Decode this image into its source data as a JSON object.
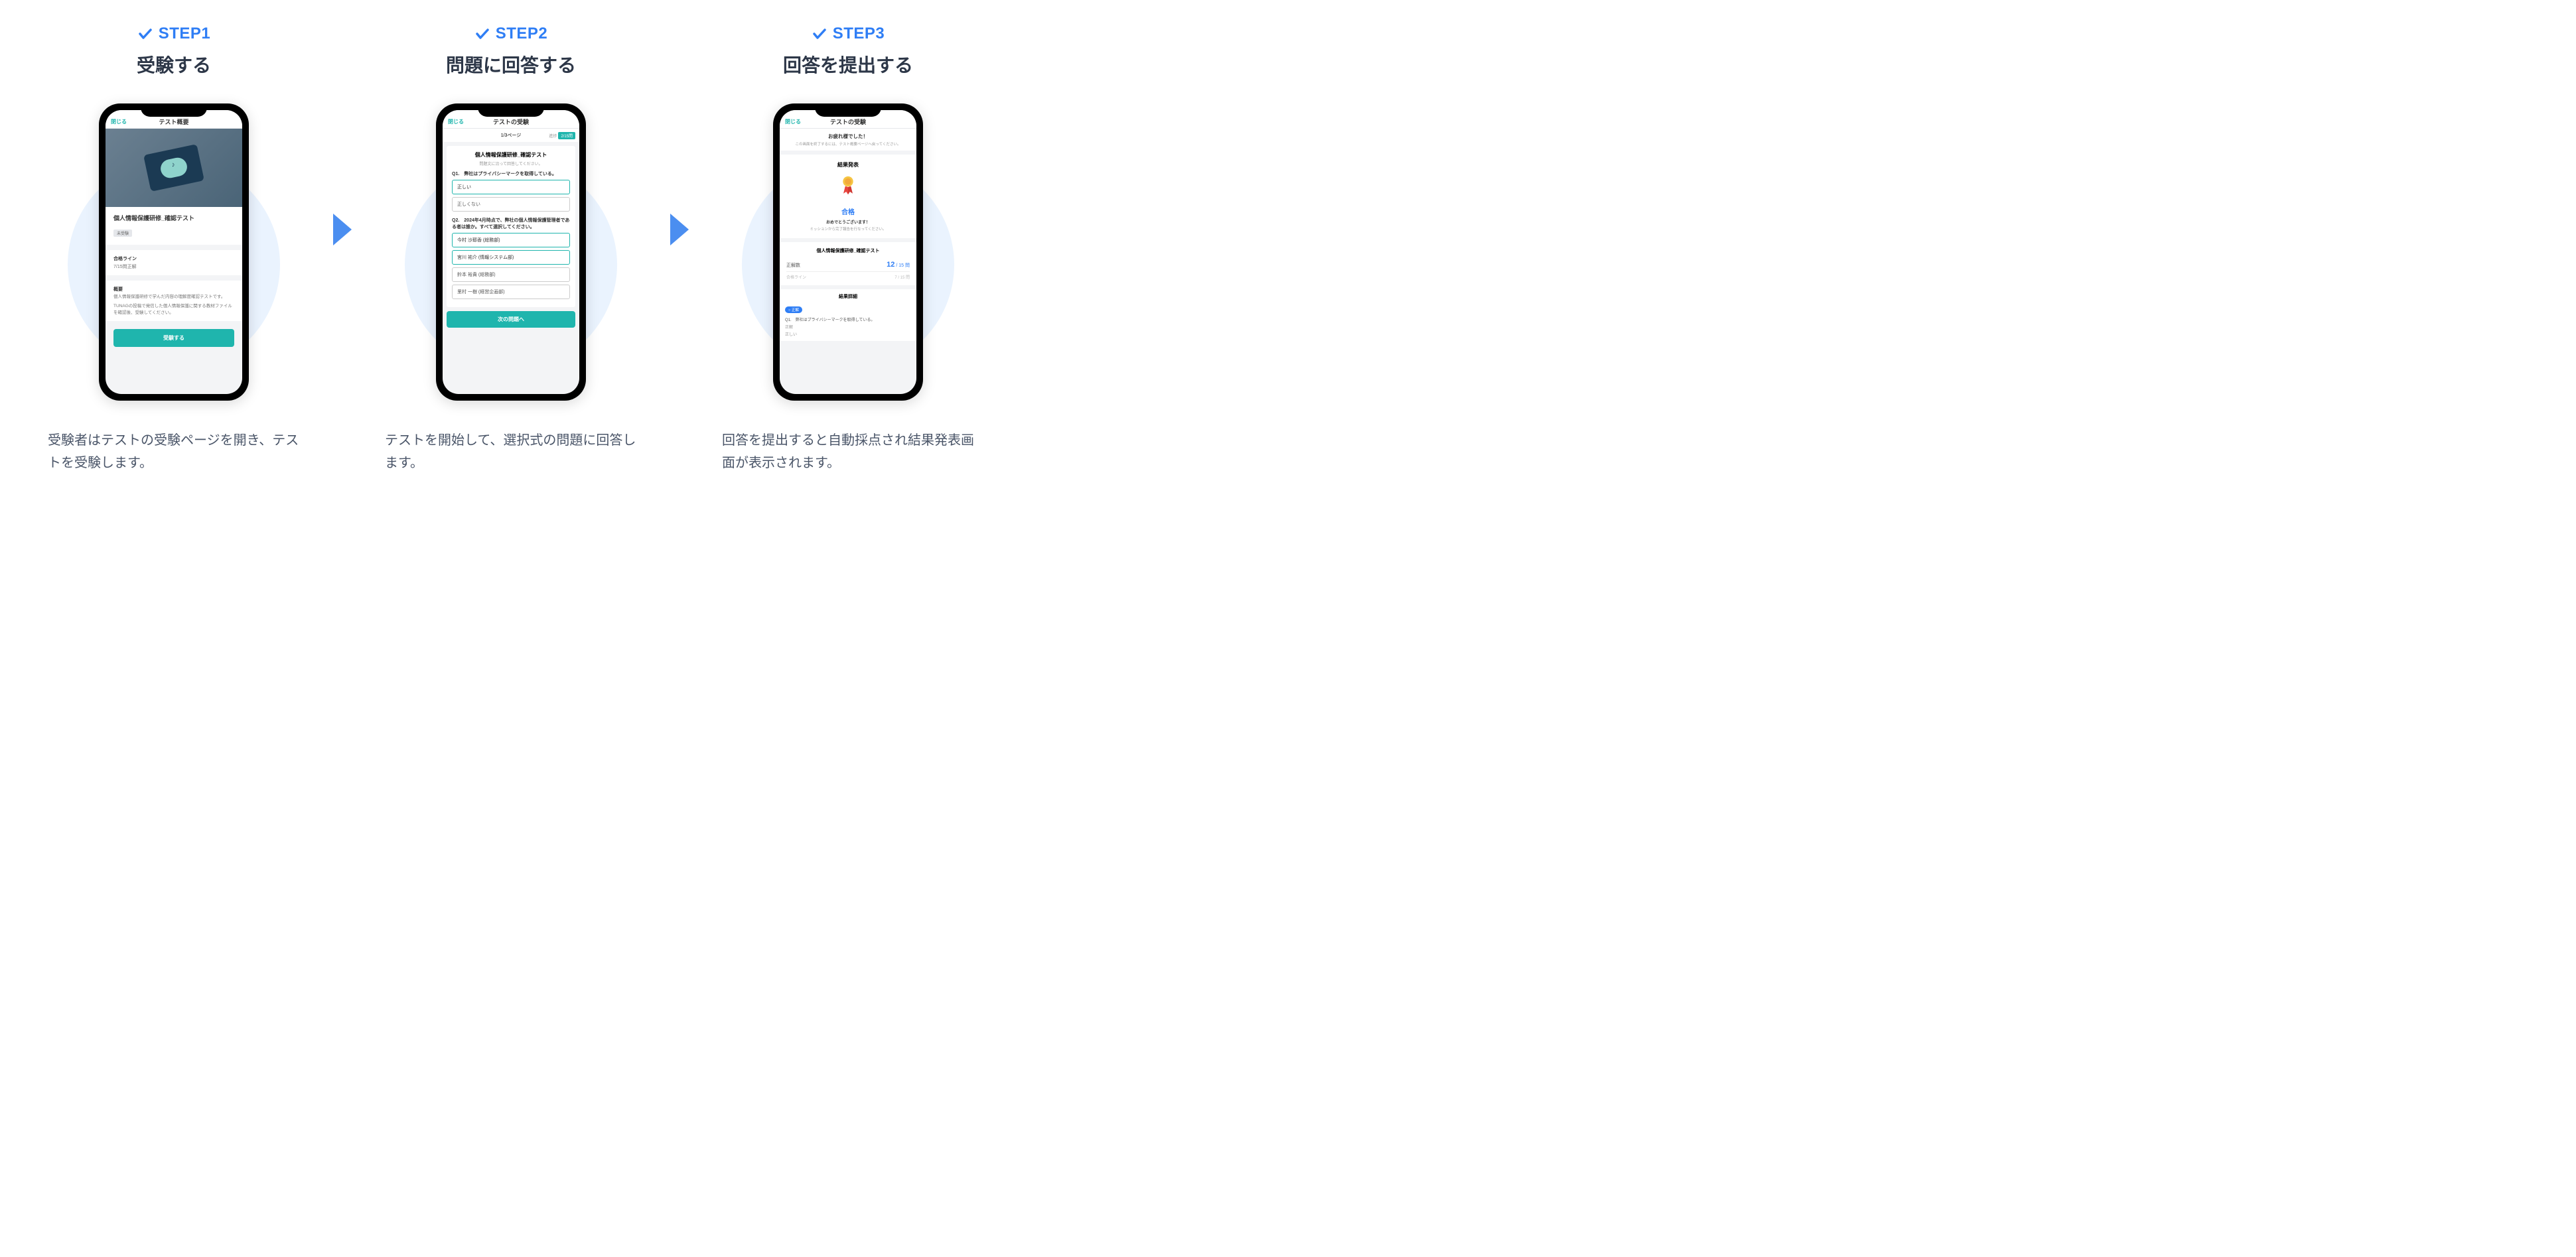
{
  "steps": [
    {
      "label": "STEP1",
      "title": "受験する",
      "description": "受験者はテストの受験ページを開き、テストを受験します。"
    },
    {
      "label": "STEP2",
      "title": "問題に回答する",
      "description": "テストを開始して、選択式の問題に回答します。"
    },
    {
      "label": "STEP3",
      "title": "回答を提出する",
      "description": "回答を提出すると自動採点され結果発表画面が表示されます。"
    }
  ],
  "screen1": {
    "close": "閉じる",
    "header": "テスト概要",
    "title": "個人情報保護研修_確認テスト",
    "status": "未受験",
    "passline_label": "合格ライン",
    "passline_val": "7/15問正解",
    "overview_label": "概要",
    "overview_text1": "個人情報保護研修で学んだ内容の理解度確認テストです。",
    "overview_text2": "TUNAGの投稿で発信した個人情報保護に関する教材ファイルを確認後、受験してください。",
    "button": "受験する"
  },
  "screen2": {
    "close": "閉じる",
    "header": "テストの受験",
    "page": "1/3ページ",
    "progress_label": "進捗",
    "progress_val": "2/15問",
    "test_title": "個人情報保護研修_確認テスト",
    "test_sub": "問題文に沿って回答してください。",
    "q1": "Q1.　弊社はプライバシーマークを取得している。",
    "q1_options": [
      "正しい",
      "正しくない"
    ],
    "q1_selected": 0,
    "q2": "Q2.　2024年4月時点で、弊社の個人情報保護管理者である者は誰か。すべて選択してください。",
    "q2_options": [
      "今村 沙耶香 (総務部)",
      "宮川 祐介 (情報システム部)",
      "鈴本 裕貴 (総務部)",
      "里村 一樹 (経営企画部)"
    ],
    "q2_selected": [
      0,
      1
    ],
    "button": "次の問題へ"
  },
  "screen3": {
    "close": "閉じる",
    "header": "テストの受験",
    "done_title": "お疲れ様でした！",
    "done_sub": "この画面を終了するには、テスト概要ページへ戻ってください。",
    "result_header": "結果発表",
    "pass": "合格",
    "congrats": "おめでとうございます！",
    "mission": "ミッションから完了報告を行なってください。",
    "score_title": "個人情報保護研修_確認テスト",
    "correct_label": "正解数",
    "correct_num": "12",
    "correct_total": " / 15 問",
    "passline_label": "合格ライン",
    "passline_val": "7 / 15 問",
    "detail_header": "結果詳細",
    "detail_badge": "○ 正解",
    "detail_q": "Q1.　弊社はプライバシーマークを取得している。",
    "detail_label": "正解",
    "detail_answer": "正しい"
  }
}
